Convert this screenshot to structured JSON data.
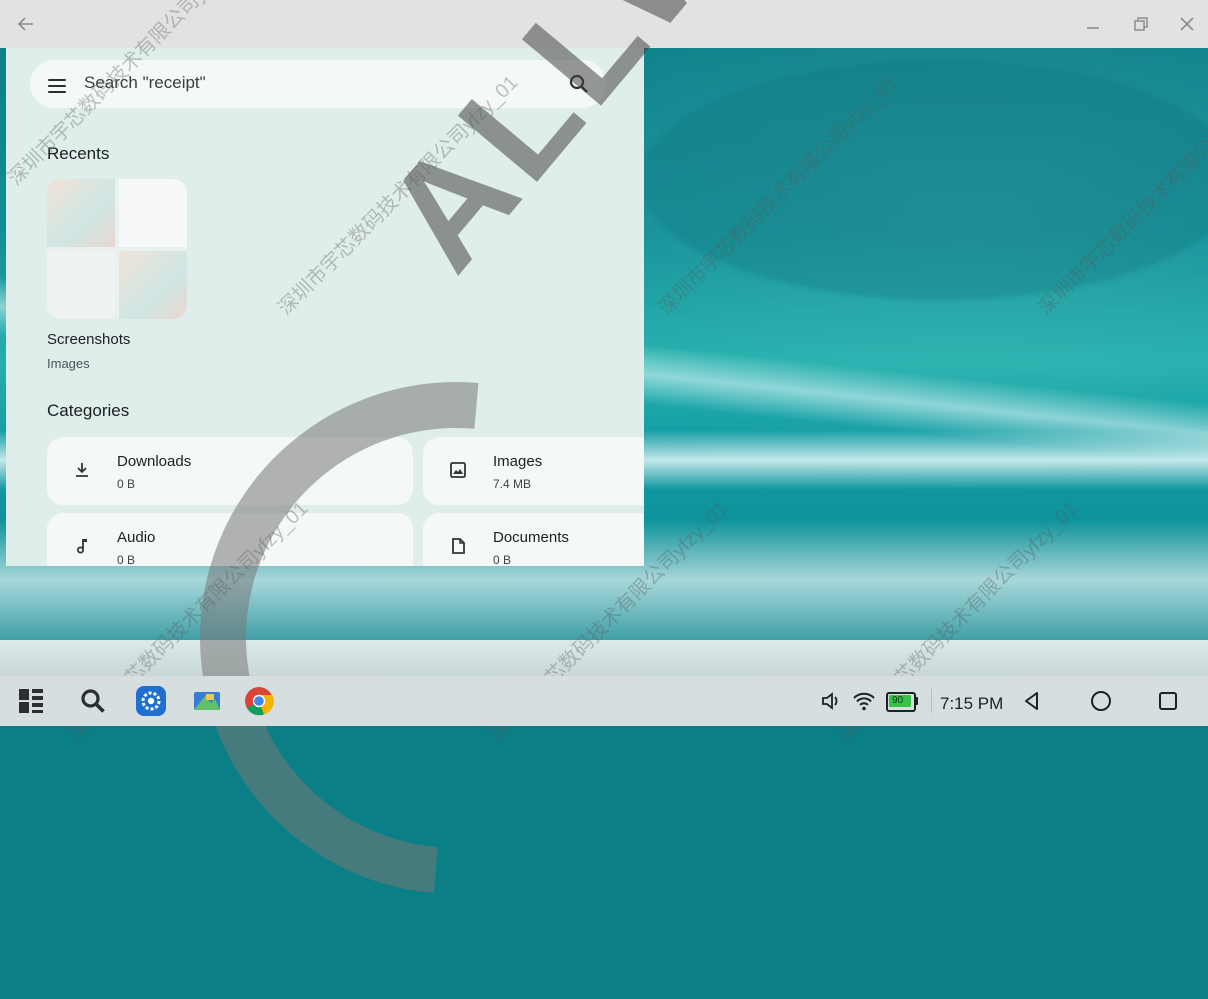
{
  "window": {
    "back_icon": "back-arrow-icon",
    "minimize_icon": "minimize-icon",
    "restore_icon": "restore-icon",
    "close_icon": "close-icon"
  },
  "search": {
    "placeholder": "Search \"receipt\""
  },
  "recents": {
    "title": "Recents",
    "item": {
      "name": "Screenshots",
      "type": "Images"
    }
  },
  "categories": {
    "title": "Categories",
    "items": [
      {
        "name": "Downloads",
        "size": "0 B",
        "icon": "download-icon"
      },
      {
        "name": "Images",
        "size": "7.4 MB",
        "icon": "image-icon"
      },
      {
        "name": "Audio",
        "size": "0 B",
        "icon": "music-note-icon"
      },
      {
        "name": "Documents",
        "size": "0 B",
        "icon": "document-icon"
      }
    ]
  },
  "taskbar": {
    "apps": [
      "app-drawer-icon",
      "search-icon",
      "settings-icon",
      "files-icon",
      "chrome-icon"
    ],
    "time": "7:15 PM",
    "battery": "90"
  },
  "watermark": {
    "brand": "ALLWINER",
    "texts": [
      "深圳市宇芯数码技术有限公司yfzy_01"
    ]
  },
  "colors": {
    "panel": "#dfedeb",
    "card": "#f4f8f7",
    "taskbar": "#d7dee0",
    "settings_blue": "#1f6fd1"
  }
}
